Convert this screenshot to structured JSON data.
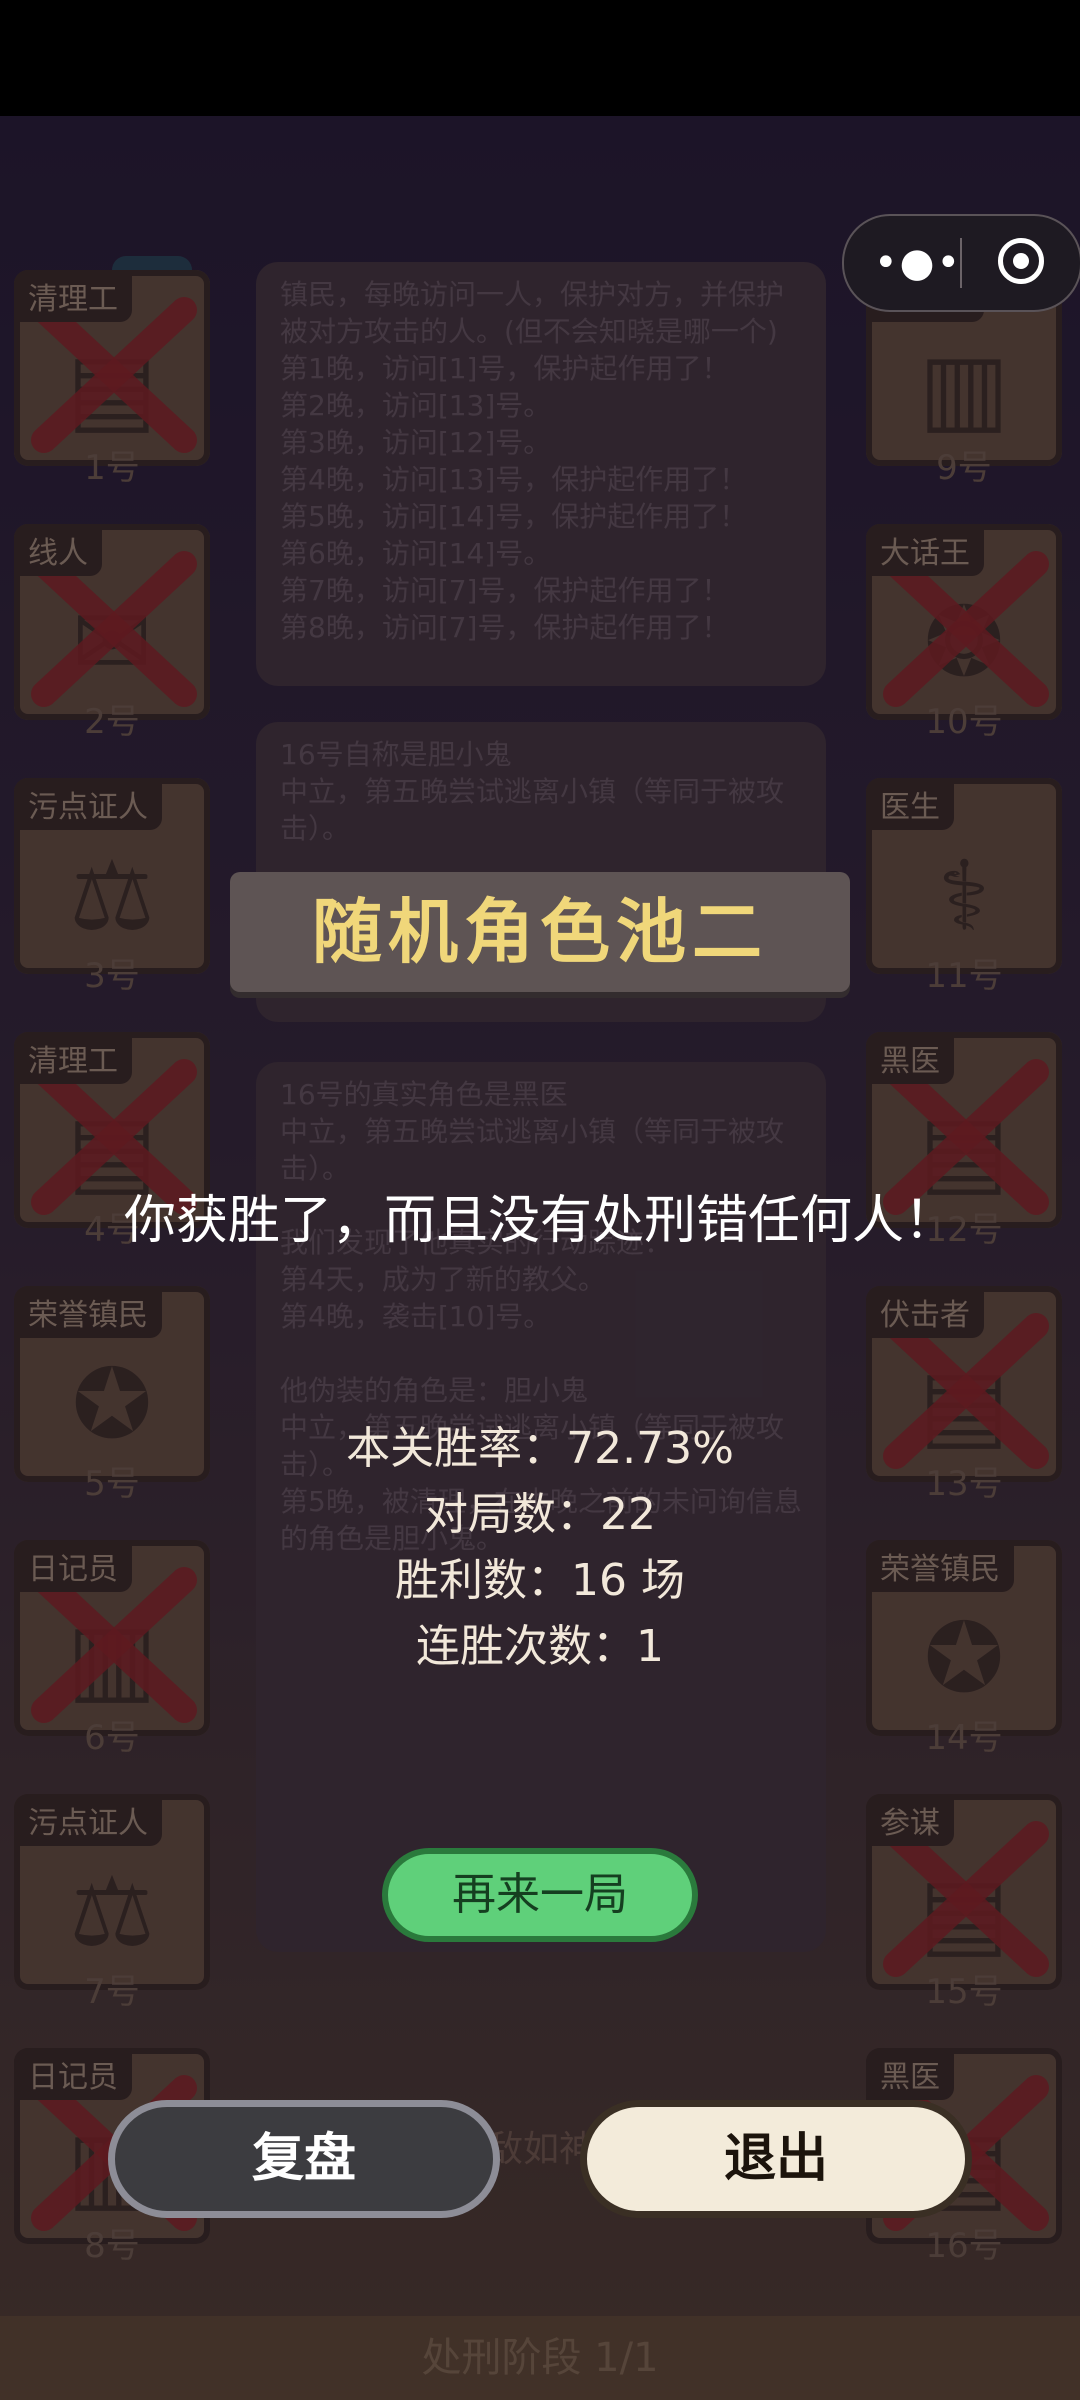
{
  "pool_title": "随机角色池二",
  "result_message": "你获胜了，而且没有处刑错任何人！",
  "stats": {
    "win_rate": "本关胜率：72.73%",
    "games": "对局数：22",
    "wins": "胜利数：16 场",
    "streak": "连胜次数：1"
  },
  "buttons": {
    "again": "再来一局",
    "replay": "复盘",
    "exit": "退出"
  },
  "phase_label": "处刑阶段 1/1",
  "hint_text": "料敌如神！",
  "left_cards": [
    {
      "role": "清理工",
      "number": "1号",
      "icon": "book-icon",
      "eliminated": true
    },
    {
      "role": "线人",
      "number": "2号",
      "icon": "envelope-icon",
      "eliminated": true
    },
    {
      "role": "污点证人",
      "number": "3号",
      "icon": "scales-handshake-icon",
      "eliminated": false
    },
    {
      "role": "清理工",
      "number": "4号",
      "icon": "book-icon",
      "eliminated": true
    },
    {
      "role": "荣誉镇民",
      "number": "5号",
      "icon": "medal-icon",
      "eliminated": false
    },
    {
      "role": "日记员",
      "number": "6号",
      "icon": "diary-icon",
      "eliminated": true
    },
    {
      "role": "污点证人",
      "number": "7号",
      "icon": "scales-handshake-icon",
      "eliminated": false
    },
    {
      "role": "日记员",
      "number": "8号",
      "icon": "diary-icon",
      "eliminated": true
    }
  ],
  "right_cards": [
    {
      "role": "日记员",
      "number": "9号",
      "icon": "diary-lock-icon",
      "eliminated": false
    },
    {
      "role": "大话王",
      "number": "10号",
      "icon": "speech-bubble-icon",
      "eliminated": true
    },
    {
      "role": "医生",
      "number": "11号",
      "icon": "syringe-icon",
      "eliminated": false
    },
    {
      "role": "黑医",
      "number": "12号",
      "icon": "book-icon",
      "eliminated": true
    },
    {
      "role": "伏击者",
      "number": "13号",
      "icon": "book-icon",
      "eliminated": true
    },
    {
      "role": "荣誉镇民",
      "number": "14号",
      "icon": "medal-icon",
      "eliminated": false
    },
    {
      "role": "参谋",
      "number": "15号",
      "icon": "book-icon",
      "eliminated": true
    },
    {
      "role": "黑医",
      "number": "16号",
      "icon": "book-icon",
      "eliminated": true
    }
  ],
  "log_panels": [
    {
      "lines": [
        "镇民，每晚访问一人，保护对方，并保护被对方攻击的人。(但不会知晓是哪一个)",
        "第1晚，访问[1]号，保护起作用了！",
        "第2晚，访问[13]号。",
        "第3晚，访问[12]号。",
        "第4晚，访问[13]号，保护起作用了！",
        "第5晚，访问[14]号，保护起作用了！",
        "第6晚，访问[14]号。",
        "第7晚，访问[7]号，保护起作用了！",
        "第8晚，访问[7]号，保护起作用了！"
      ]
    },
    {
      "lines": [
        "16号自称是胆小鬼",
        "中立，第五晚尝试逃离小镇（等同于被攻击）。"
      ]
    },
    {
      "lines": [
        "16号的真实角色是黑医",
        "中立，第五晚尝试逃离小镇（等同于被攻击）。",
        "",
        "我们发现了他真实的行动踪迹：",
        "第4天，成为了新的教父。",
        "第4晚，袭击[10]号。",
        "",
        "他伪装的角色是：胆小鬼",
        "中立，第五晚尝试逃离小镇（等同于被攻击）。",
        "第5晚，被清理，在本晚之前的未问询信息",
        "的角色是胆小鬼。"
      ]
    }
  ]
}
